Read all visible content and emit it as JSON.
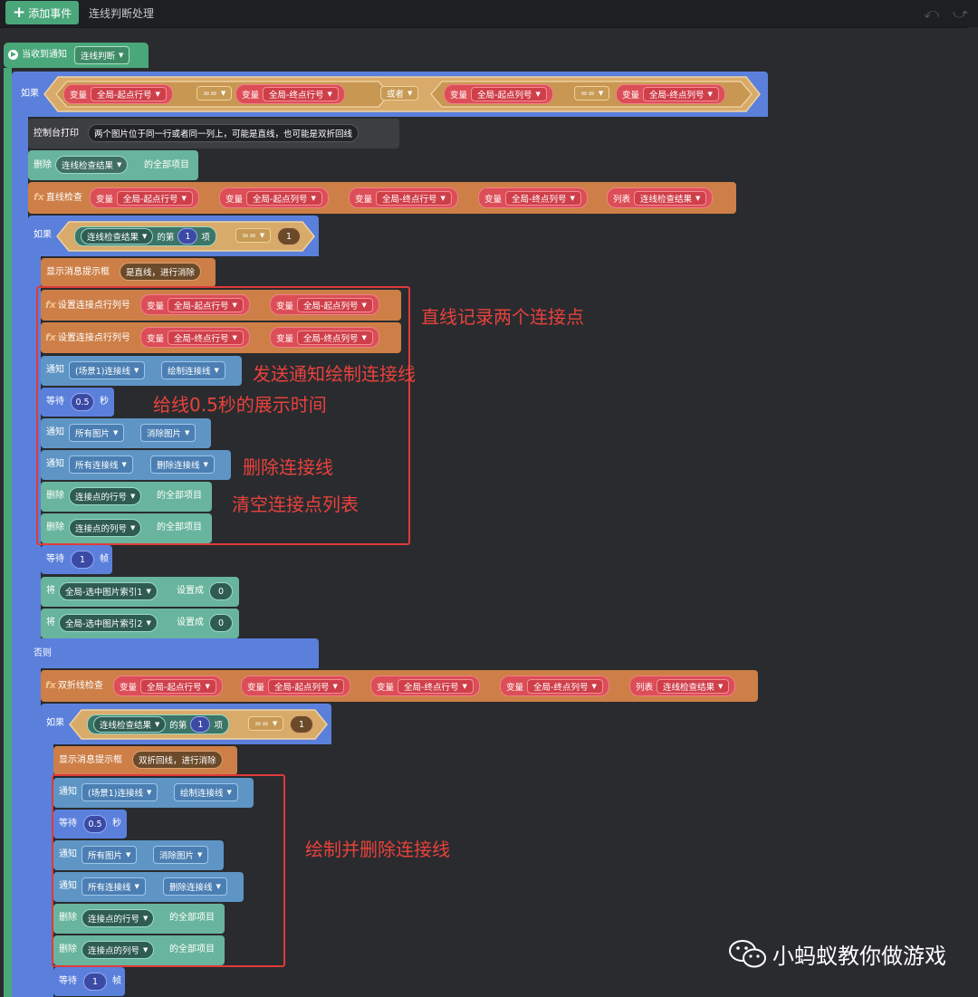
{
  "toolbar": {
    "add_event": "添加事件",
    "tab_title": "连线判断处理",
    "undo_icon": "undo-icon",
    "redo_icon": "redo-icon"
  },
  "event": {
    "label": "当收到通知",
    "notice": "连线判断"
  },
  "if1": {
    "label": "如果",
    "or_label": "或者",
    "var": "变量",
    "left": {
      "a": "全局-起点行号",
      "op": "==",
      "b": "全局-终点行号"
    },
    "right": {
      "a": "全局-起点列号",
      "op": "==",
      "b": "全局-终点列号"
    }
  },
  "print": {
    "label": "控制台打印",
    "text": "两个图片位于同一行或者同一列上，可能是直线，也可能是双折回线"
  },
  "del_all": {
    "label": "删除",
    "list": "连线检查结果",
    "suffix": "的全部项目"
  },
  "line_check": {
    "label": "直线检查",
    "var": "变量",
    "args": [
      "全局-起点行号",
      "全局-起点列号",
      "全局-终点行号",
      "全局-终点列号"
    ],
    "list_label": "列表",
    "list": "连线检查结果"
  },
  "if2": {
    "label": "如果",
    "list": "连线检查结果",
    "of": "的第",
    "index": "1",
    "item": "项",
    "op": "==",
    "value": "1"
  },
  "msg1": {
    "label": "显示消息提示框",
    "text": "是直线，进行消除"
  },
  "set1": {
    "label": "设置连接点行列号",
    "var": "变量",
    "a": "全局-起点行号",
    "b": "全局-起点列号"
  },
  "set2": {
    "label": "设置连接点行列号",
    "var": "变量",
    "a": "全局-终点行号",
    "b": "全局-终点列号"
  },
  "notify_draw": {
    "label": "通知",
    "target": "(场景1)连接线",
    "msg": "绘制连接线"
  },
  "wait1": {
    "label": "等待",
    "value": "0.5",
    "unit": "秒"
  },
  "notify_img": {
    "label": "通知",
    "target": "所有图片",
    "msg": "消除图片"
  },
  "notify_del": {
    "label": "通知",
    "target": "所有连接线",
    "msg": "删除连接线"
  },
  "del_rows": {
    "label": "删除",
    "list": "连接点的行号",
    "suffix": "的全部项目"
  },
  "del_cols": {
    "label": "删除",
    "list": "连接点的列号",
    "suffix": "的全部项目"
  },
  "wait_frame": {
    "label": "等待",
    "value": "1",
    "unit": "帧"
  },
  "set_idx1": {
    "label": "将",
    "var": "全局-选中图片索引1",
    "to": "设置成",
    "value": "0"
  },
  "set_idx2": {
    "label": "将",
    "var": "全局-选中图片索引2",
    "to": "设置成",
    "value": "0"
  },
  "else_label": "否则",
  "double_check": {
    "label": "双折线检查",
    "var": "变量",
    "args": [
      "全局-起点行号",
      "全局-起点列号",
      "全局-终点行号",
      "全局-终点列号"
    ],
    "list_label": "列表",
    "list": "连线检查结果"
  },
  "if3": {
    "label": "如果",
    "list": "连线检查结果",
    "of": "的第",
    "index": "1",
    "item": "项",
    "op": "==",
    "value": "1"
  },
  "msg2": {
    "label": "显示消息提示框",
    "text": "双折回线，进行消除"
  },
  "annotations": {
    "a1": "直线记录两个连接点",
    "a2": "发送通知绘制连接线",
    "a3": "给线0.5秒的展示时间",
    "a4": "删除连接线",
    "a5": "清空连接点列表",
    "a6": "绘制并删除连接线"
  },
  "watermark": "小蚂蚁教你做游戏",
  "colors": {
    "event": "#4aa77a",
    "control": "#5b80dc",
    "notify": "#5e95c5",
    "list": "#68b49c",
    "function": "#cd7f47",
    "variable": "#dc4e57",
    "annotation": "#e03a3a"
  }
}
